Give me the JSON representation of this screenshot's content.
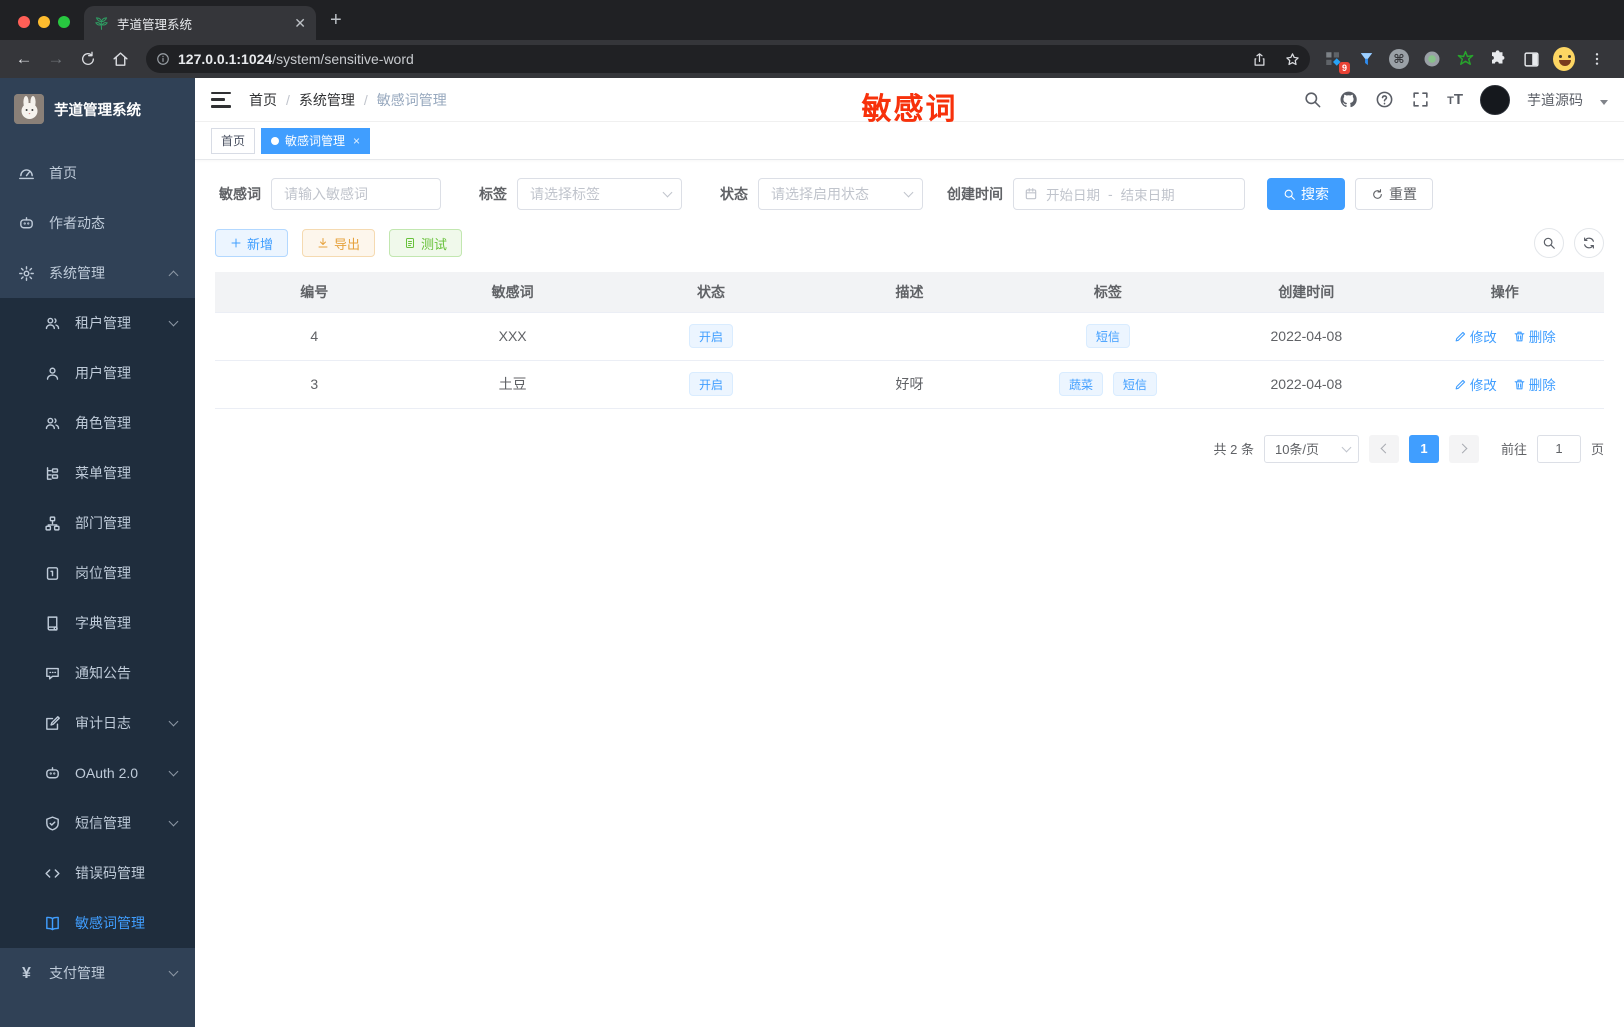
{
  "browser": {
    "tab_title": "芋道管理系统",
    "url_host": "127.0.0.1:1024",
    "url_path": "/system/sensitive-word",
    "ext_badge": "9"
  },
  "sidebar": {
    "logo_title": "芋道管理系统",
    "items": [
      {
        "label": "首页"
      },
      {
        "label": "作者动态"
      },
      {
        "label": "系统管理"
      },
      {
        "label": "租户管理"
      },
      {
        "label": "用户管理"
      },
      {
        "label": "角色管理"
      },
      {
        "label": "菜单管理"
      },
      {
        "label": "部门管理"
      },
      {
        "label": "岗位管理"
      },
      {
        "label": "字典管理"
      },
      {
        "label": "通知公告"
      },
      {
        "label": "审计日志"
      },
      {
        "label": "OAuth 2.0"
      },
      {
        "label": "短信管理"
      },
      {
        "label": "错误码管理"
      },
      {
        "label": "敏感词管理"
      },
      {
        "label": "支付管理"
      }
    ]
  },
  "navbar": {
    "breadcrumb": {
      "0": "首页",
      "1": "系统管理",
      "2": "敏感词管理",
      "sep": "/"
    },
    "watermark": "敏感词",
    "user_name": "芋道源码"
  },
  "tags": {
    "home": "首页",
    "current": "敏感词管理"
  },
  "filters": {
    "keyword_label": "敏感词",
    "keyword_placeholder": "请输入敏感词",
    "tag_label": "标签",
    "tag_placeholder": "请选择标签",
    "status_label": "状态",
    "status_placeholder": "请选择启用状态",
    "date_label": "创建时间",
    "date_start": "开始日期",
    "date_sep": "-",
    "date_end": "结束日期",
    "search_label": "搜索",
    "reset_label": "重置"
  },
  "toolbar": {
    "add_label": "新增",
    "export_label": "导出",
    "test_label": "测试"
  },
  "table": {
    "headers": [
      "编号",
      "敏感词",
      "状态",
      "描述",
      "标签",
      "创建时间",
      "操作"
    ],
    "edit_label": "修改",
    "delete_label": "删除",
    "rows": [
      {
        "id": "4",
        "word": "XXX",
        "status": "开启",
        "desc": "",
        "tags": [
          "短信"
        ],
        "created": "2022-04-08"
      },
      {
        "id": "3",
        "word": "土豆",
        "status": "开启",
        "desc": "好呀",
        "tags": [
          "蔬菜",
          "短信"
        ],
        "created": "2022-04-08"
      }
    ]
  },
  "pagination": {
    "total": "共 2 条",
    "page_size": "10条/页",
    "page": "1",
    "goto_label": "前往",
    "goto_value": "1",
    "unit_label": "页"
  },
  "colors": {
    "primary": "#409eff",
    "watermark_red": "#f7310b",
    "sidebar_bg": "#304156",
    "submenu_bg": "#1f2d3d",
    "sidebar_text": "#bfcbd9",
    "tag_bg": "#ecf5ff",
    "tag_border": "#d9ecff",
    "warning": "#e6a23c",
    "success": "#67c23a"
  }
}
